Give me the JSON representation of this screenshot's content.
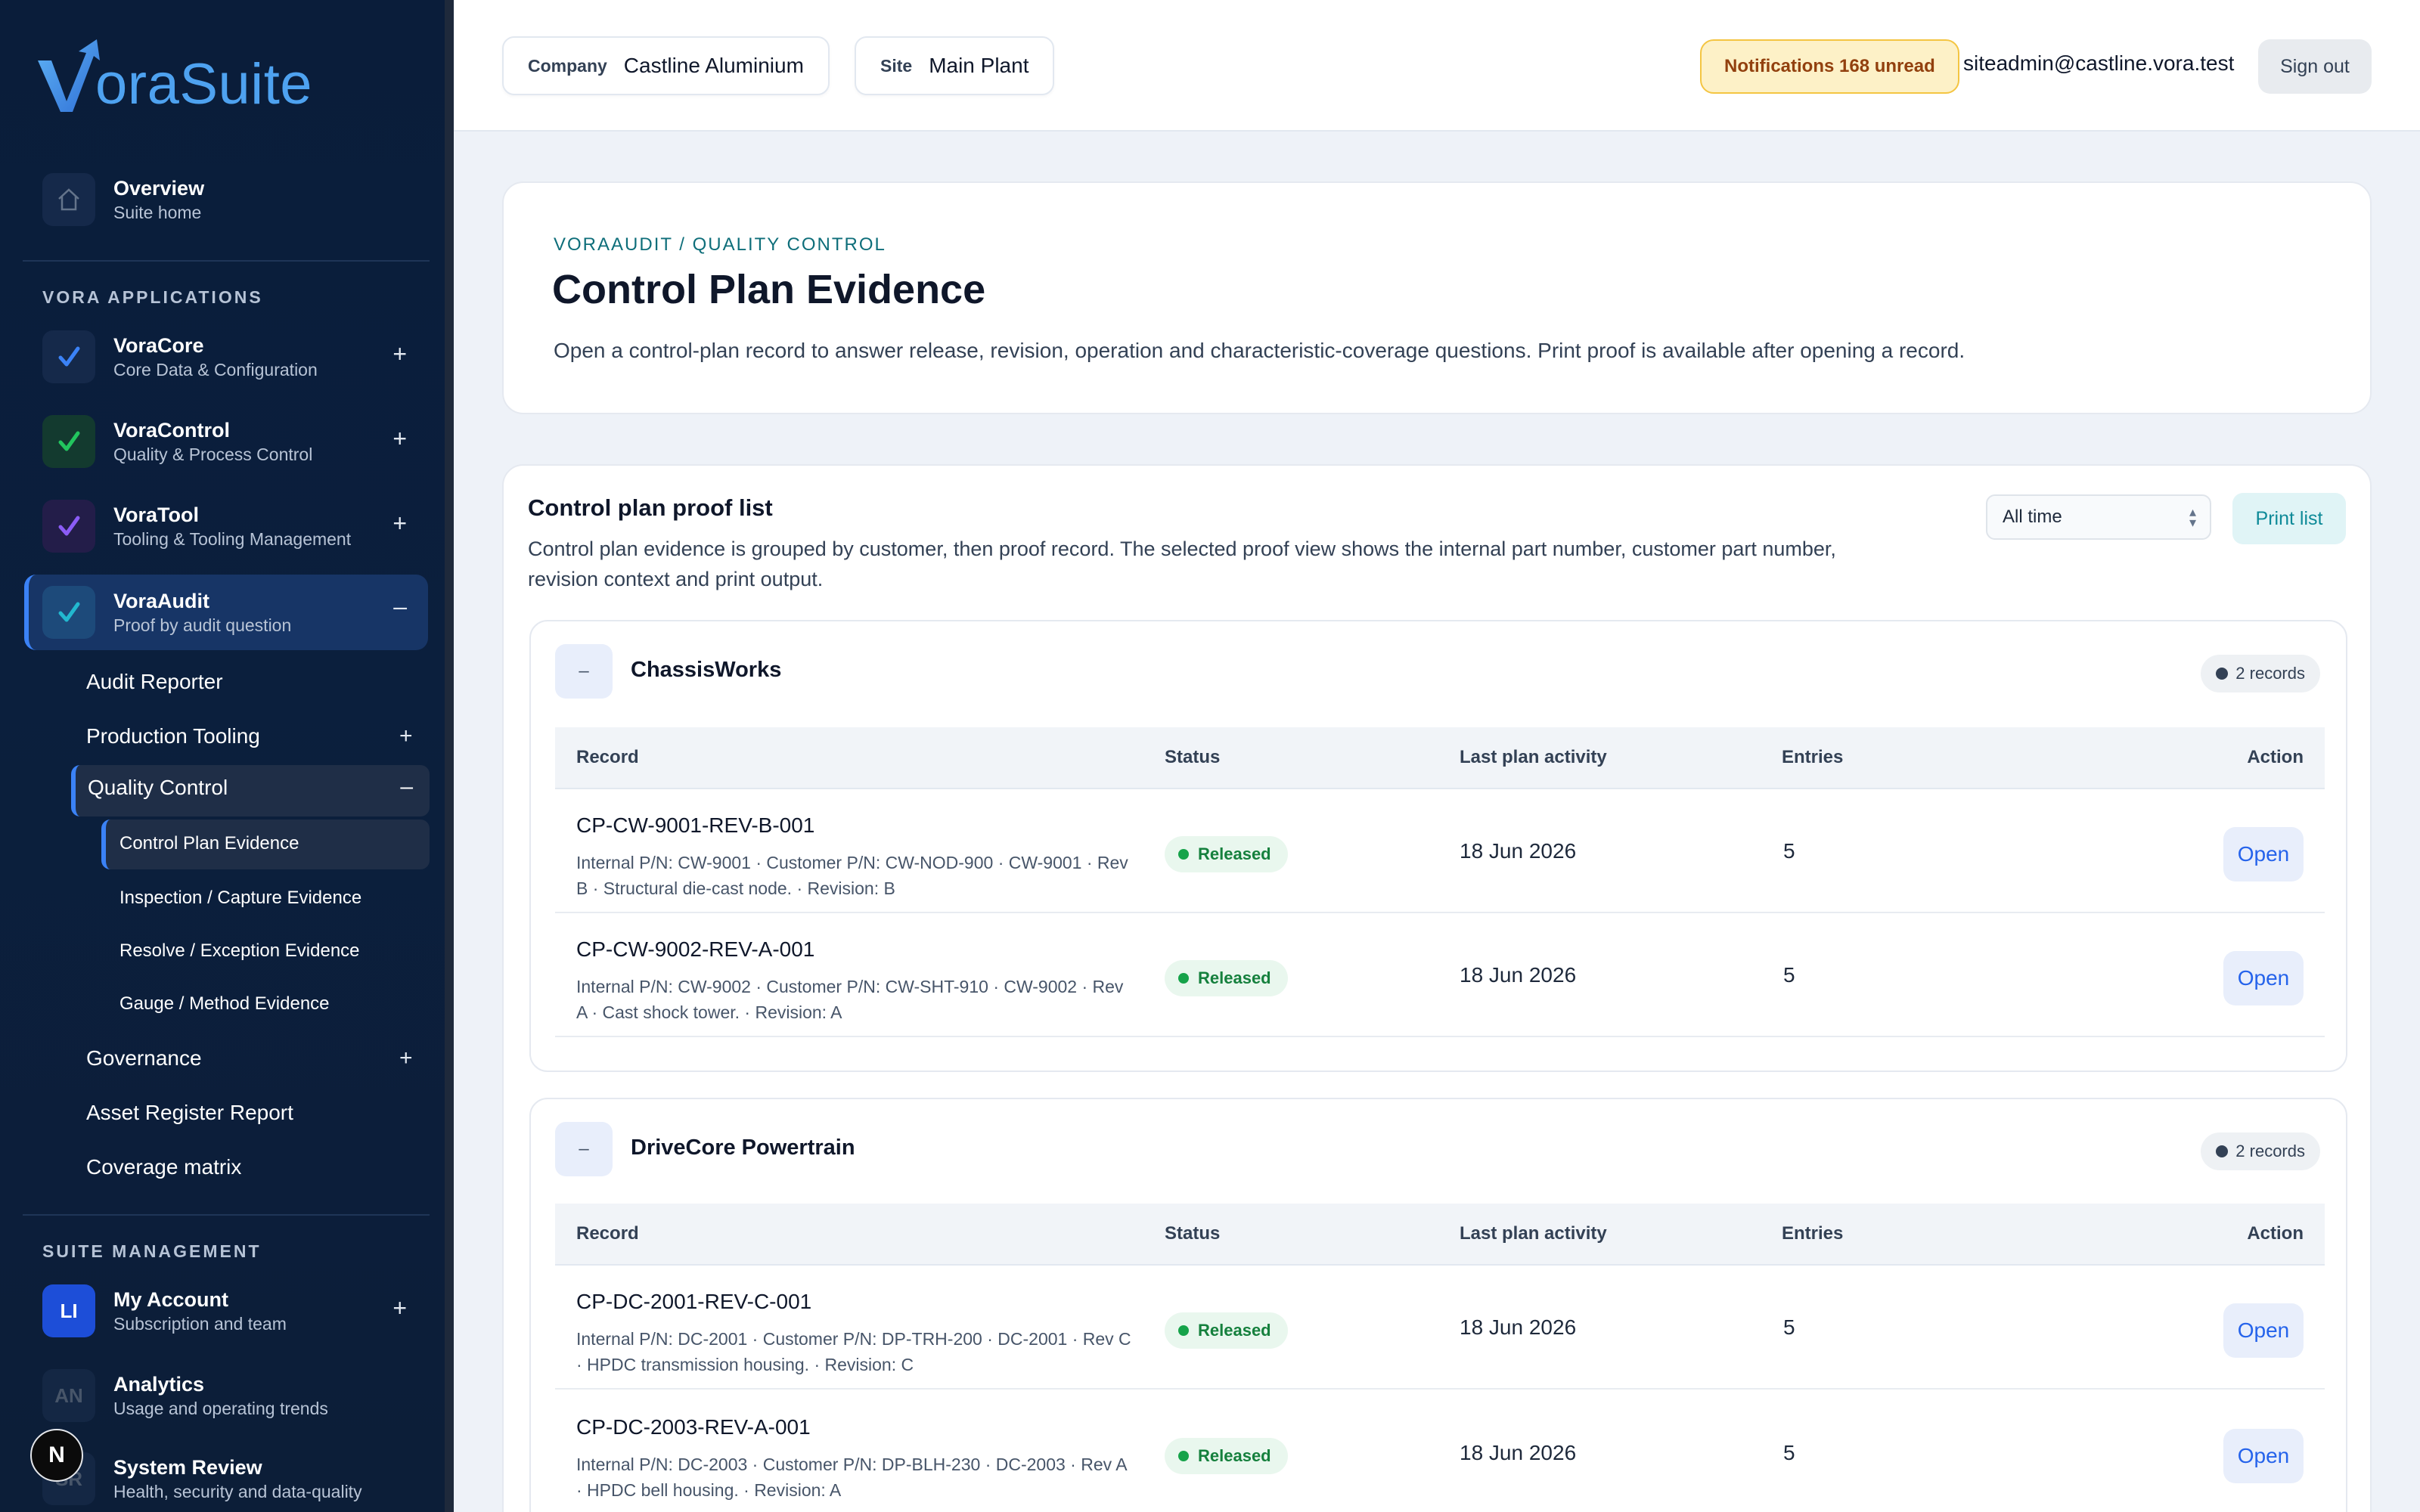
{
  "brand": {
    "name": "oraSuite",
    "letter": "V"
  },
  "sidebar": {
    "overview": {
      "title": "Overview",
      "subtitle": "Suite home"
    },
    "apps_label": "VORA APPLICATIONS",
    "apps": [
      {
        "title": "VoraCore",
        "subtitle": "Core Data & Configuration",
        "toggle": "+"
      },
      {
        "title": "VoraControl",
        "subtitle": "Quality & Process Control",
        "toggle": "+"
      },
      {
        "title": "VoraTool",
        "subtitle": "Tooling & Tooling Management",
        "toggle": "+"
      },
      {
        "title": "VoraAudit",
        "subtitle": "Proof by audit question",
        "toggle": "–"
      }
    ],
    "audit_items": [
      {
        "label": "Audit Reporter"
      },
      {
        "label": "Production Tooling",
        "toggle": "+"
      },
      {
        "label": "Quality Control",
        "toggle": "–"
      },
      {
        "label": "Governance",
        "toggle": "+"
      },
      {
        "label": "Asset Register Report"
      },
      {
        "label": "Coverage matrix"
      }
    ],
    "qc_items": [
      "Control Plan Evidence",
      "Inspection / Capture Evidence",
      "Resolve / Exception Evidence",
      "Gauge / Method Evidence"
    ],
    "mgmt_label": "SUITE MANAGEMENT",
    "mgmt": [
      {
        "badge": "LI",
        "title": "My Account",
        "subtitle": "Subscription and team",
        "toggle": "+"
      },
      {
        "badge": "AN",
        "title": "Analytics",
        "subtitle": "Usage and operating trends"
      },
      {
        "badge": "SR",
        "title": "System Review",
        "subtitle": "Health, security and data-quality"
      }
    ],
    "floating_badge": "N"
  },
  "header": {
    "company_label": "Company",
    "company_value": "Castline Aluminium",
    "site_label": "Site",
    "site_value": "Main Plant",
    "notifications": "Notifications 168 unread",
    "user": "siteadmin@castline.vora.test",
    "signout": "Sign out"
  },
  "hero": {
    "breadcrumb": "VORAAUDIT / QUALITY CONTROL",
    "title": "Control Plan Evidence",
    "description": "Open a control-plan record to answer release, revision, operation and characteristic-coverage questions. Print proof is available after opening a record."
  },
  "panel": {
    "title": "Control plan proof list",
    "description": "Control plan evidence is grouped by customer, then proof record. The selected proof view shows the internal part number, customer part number, revision context and print output.",
    "filter_value": "All time",
    "print_label": "Print list",
    "columns": {
      "record": "Record",
      "status": "Status",
      "last": "Last plan activity",
      "entries": "Entries",
      "action": "Action"
    },
    "groups": [
      {
        "toggle": "–",
        "name": "ChassisWorks",
        "count": "2 records",
        "rows": [
          {
            "id": "CP-CW-9001-REV-B-001",
            "desc": "Internal P/N: CW-9001 · Customer P/N: CW-NOD-900 · CW-9001 · Rev B · Structural die-cast node. · Revision: B",
            "status": "Released",
            "date": "18 Jun 2026",
            "entries": "5",
            "action": "Open"
          },
          {
            "id": "CP-CW-9002-REV-A-001",
            "desc": "Internal P/N: CW-9002 · Customer P/N: CW-SHT-910 · CW-9002 · Rev A · Cast shock tower. · Revision: A",
            "status": "Released",
            "date": "18 Jun 2026",
            "entries": "5",
            "action": "Open"
          }
        ]
      },
      {
        "toggle": "–",
        "name": "DriveCore Powertrain",
        "count": "2 records",
        "rows": [
          {
            "id": "CP-DC-2001-REV-C-001",
            "desc": "Internal P/N: DC-2001 · Customer P/N: DP-TRH-200 · DC-2001 · Rev C · HPDC transmission housing. · Revision: C",
            "status": "Released",
            "date": "18 Jun 2026",
            "entries": "5",
            "action": "Open"
          },
          {
            "id": "CP-DC-2003-REV-A-001",
            "desc": "Internal P/N: DC-2003 · Customer P/N: DP-BLH-230 · DC-2003 · Rev A · HPDC bell housing. · Revision: A",
            "status": "Released",
            "date": "18 Jun 2026",
            "entries": "5",
            "action": "Open"
          }
        ]
      }
    ]
  },
  "colors": {
    "sidebar_bg": "#0b1f3d",
    "accent": "#3b82f6",
    "logo": "#4ea2f0",
    "released": "#16a34a",
    "notif_bg": "#fdf1c7",
    "notif_border": "#f4c542"
  },
  "icons": {
    "overview": "home-icon",
    "voracore": "check-icon",
    "voracontrol": "check-icon",
    "voratool": "check-icon",
    "voraaudit": "check-icon",
    "select": "up-down-chevron-icon"
  }
}
